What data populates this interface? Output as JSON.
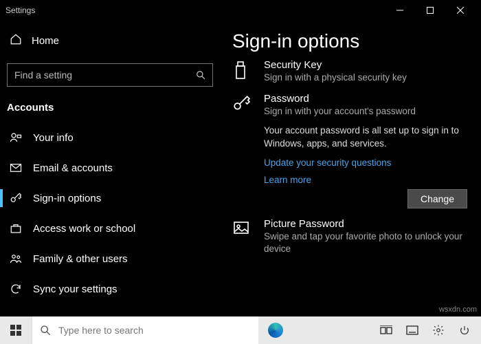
{
  "titlebar": {
    "title": "Settings"
  },
  "sidebar": {
    "home": "Home",
    "search_placeholder": "Find a setting",
    "section": "Accounts",
    "items": [
      {
        "label": "Your info"
      },
      {
        "label": "Email & accounts"
      },
      {
        "label": "Sign-in options"
      },
      {
        "label": "Access work or school"
      },
      {
        "label": "Family & other users"
      },
      {
        "label": "Sync your settings"
      }
    ]
  },
  "main": {
    "heading": "Sign-in options",
    "security_key": {
      "title": "Security Key",
      "sub": "Sign in with a physical security key"
    },
    "password": {
      "title": "Password",
      "sub": "Sign in with your account's password",
      "desc": "Your account password is all set up to sign in to Windows, apps, and services.",
      "link1": "Update your security questions",
      "link2": "Learn more",
      "change": "Change"
    },
    "picture": {
      "title": "Picture Password",
      "sub": "Swipe and tap your favorite photo to unlock your device"
    }
  },
  "taskbar": {
    "search_placeholder": "Type here to search"
  },
  "watermark": "wsxdn.com"
}
